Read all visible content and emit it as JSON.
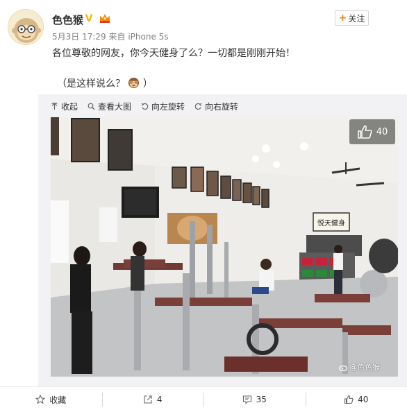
{
  "user": {
    "name": "色色猴",
    "verified_badge": "V",
    "avatar_icon": "monkey-avatar",
    "vip_icon": "crown-icon"
  },
  "post_meta": {
    "date": "5月3日 17:29",
    "source_prefix": "来自",
    "source": "iPhone 5s"
  },
  "follow": {
    "plus": "+",
    "label": "关注"
  },
  "content": {
    "line1": "各位尊敬的网友，你今天健身了么？一切都是刚刚开始！",
    "line2_open": "（是这样说么？",
    "line2_close": "）",
    "emoji_icon": "see-no-evil-monkey-icon"
  },
  "media_toolbar": {
    "collapse": "收起",
    "view_large": "查看大图",
    "rotate_left": "向左旋转",
    "rotate_right": "向右旋转"
  },
  "photo": {
    "like_count": "40",
    "watermark": "@色色猴",
    "sign_text": "悦天健身"
  },
  "actions": {
    "favorite": "收藏",
    "repost": "4",
    "comment": "35",
    "like": "40"
  },
  "colors": {
    "accent": "#ff8200",
    "text": "#333333",
    "meta": "#808080",
    "media_bg": "#f2f2f5"
  }
}
